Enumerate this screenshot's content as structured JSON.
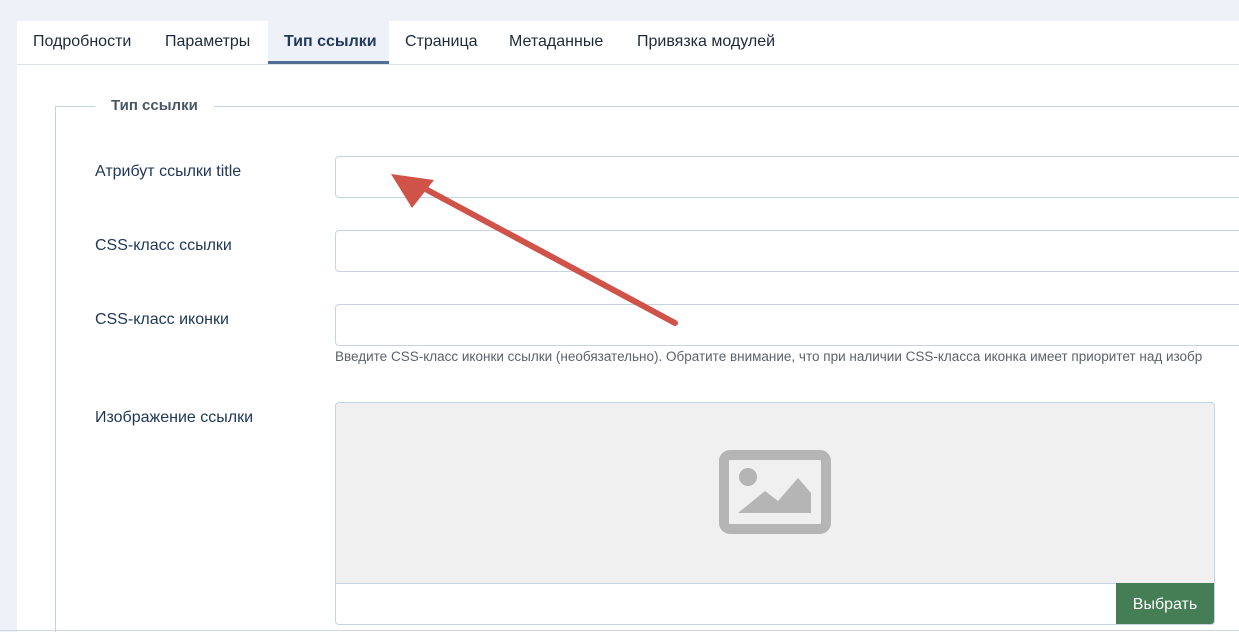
{
  "tabs": [
    {
      "label": "Подробности",
      "active": false
    },
    {
      "label": "Параметры",
      "active": false
    },
    {
      "label": "Тип ссылки",
      "active": true
    },
    {
      "label": "Страница",
      "active": false
    },
    {
      "label": "Метаданные",
      "active": false
    },
    {
      "label": "Привязка модулей",
      "active": false
    }
  ],
  "fieldset": {
    "legend": "Тип ссылки",
    "fields": {
      "title_attr": {
        "label": "Атрибут ссылки title",
        "value": ""
      },
      "css_class": {
        "label": "CSS-класс ссылки",
        "value": ""
      },
      "icon_class": {
        "label": "CSS-класс иконки",
        "value": "",
        "hint": "Введите CSS-класс иконки ссылки (необязательно). Обратите внимание, что при наличии CSS-класса иконка имеет приоритет над изобр"
      },
      "image": {
        "label": "Изображение ссылки",
        "value": "",
        "button": "Выбрать",
        "icon": "image-placeholder-icon"
      }
    }
  },
  "annotation": {
    "type": "arrow",
    "color": "#d0534a"
  },
  "colors": {
    "active_tab": "#22395f",
    "label": "#1e3658",
    "button": "#457d54",
    "background": "#eef2f8"
  }
}
